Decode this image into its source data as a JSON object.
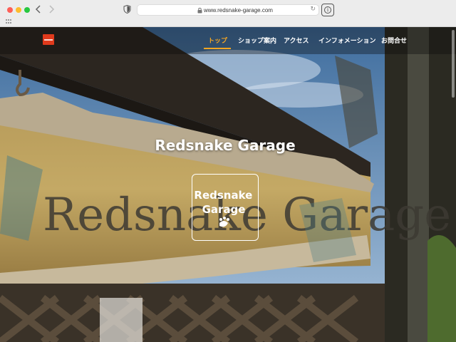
{
  "browser": {
    "url": "www.redsnake-garage.com",
    "back_icon": "chevron-left-icon",
    "forward_icon": "chevron-right-icon",
    "reload_icon": "reload-icon"
  },
  "site": {
    "nav": [
      {
        "label": "トップ",
        "active": true
      },
      {
        "label": "ショップ案内",
        "active": false
      },
      {
        "label": "アクセス",
        "active": false
      },
      {
        "label": "インフォメーション",
        "active": false
      },
      {
        "label": "お問合せ",
        "active": false
      }
    ],
    "hero_title": "Redsnake Garage",
    "hero_logo_text": "Redsnake Garage",
    "sign_text": "Redsnake Garage"
  },
  "colors": {
    "accent": "#f5a623",
    "logo_red": "#e03a1c"
  }
}
